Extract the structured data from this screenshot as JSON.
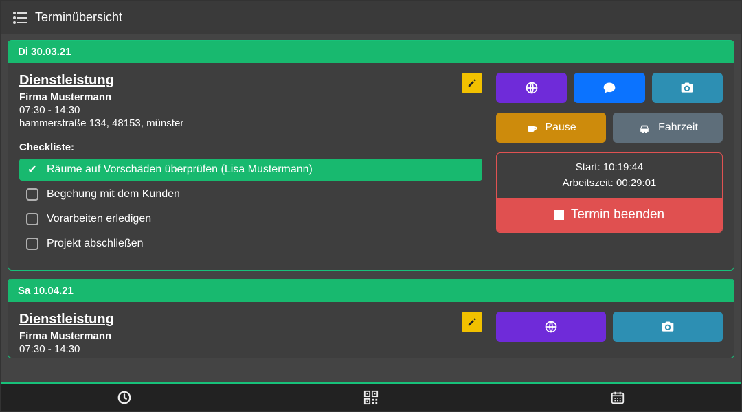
{
  "header": {
    "title": "Terminübersicht"
  },
  "appointments": [
    {
      "date": "Di 30.03.21",
      "service": "Dienstleistung",
      "company": "Firma Mustermann",
      "time": "07:30 - 14:30",
      "address": "hammerstraße 134, 48153, münster",
      "checklist_label": "Checkliste:",
      "checklist": [
        {
          "text": "Räume auf Vorschäden überprüfen (Lisa Mustermann)",
          "done": true
        },
        {
          "text": "Begehung mit dem Kunden",
          "done": false
        },
        {
          "text": "Vorarbeiten erledigen",
          "done": false
        },
        {
          "text": "Projekt abschließen",
          "done": false
        }
      ],
      "actions": {
        "pause_label": "Pause",
        "travel_label": "Fahrzeit",
        "start_line": "Start: 10:19:44",
        "worktime_line": "Arbeitszeit: 00:29:01",
        "end_label": "Termin beenden"
      }
    },
    {
      "date": "Sa 10.04.21",
      "service": "Dienstleistung",
      "company": "Firma Mustermann",
      "time": "07:30 - 14:30"
    }
  ]
}
